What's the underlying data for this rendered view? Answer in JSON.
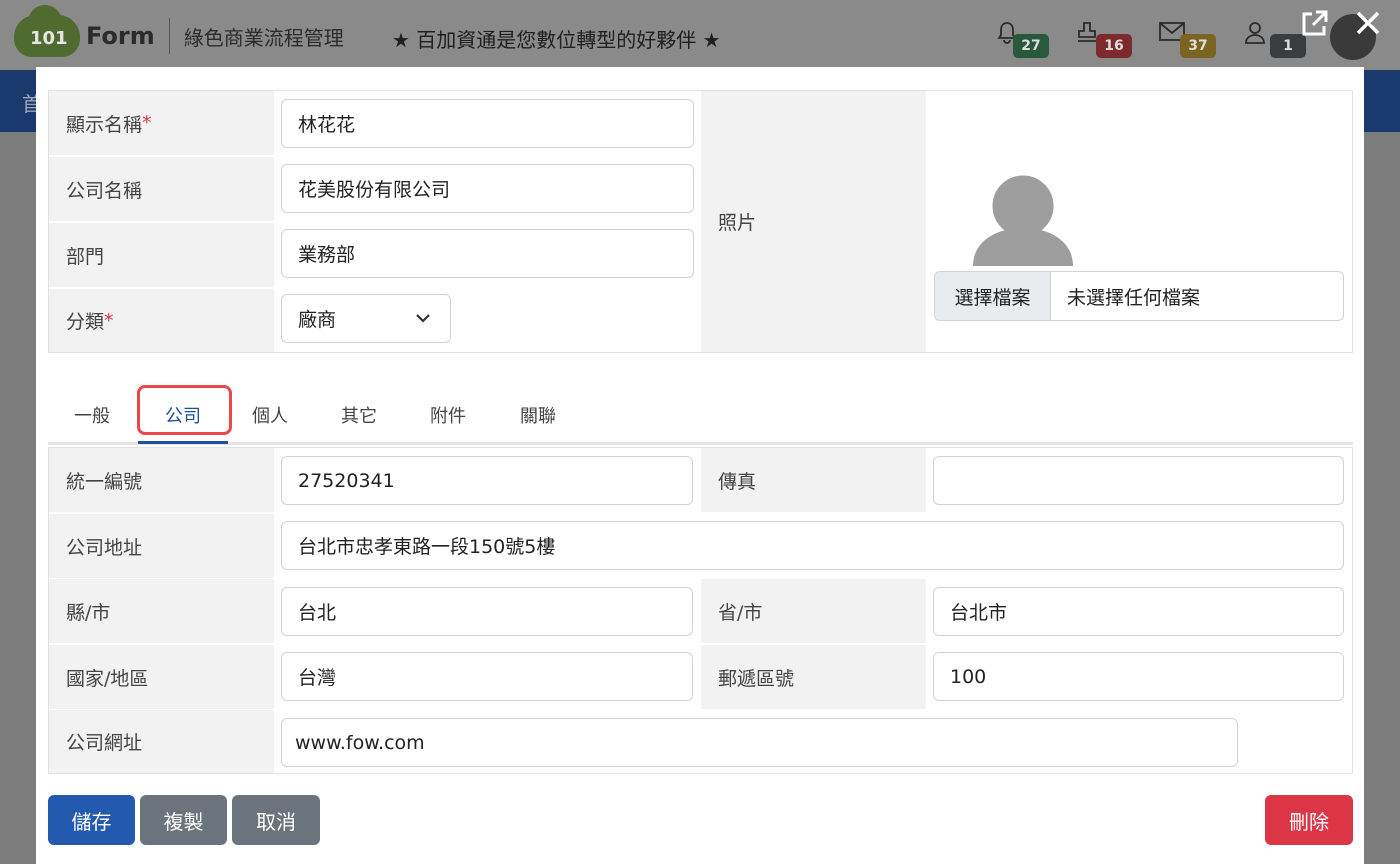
{
  "app": {
    "logo_number": "101",
    "logo_text": "Form",
    "subtitle": "綠色商業流程管理",
    "slogan": "★ 百加資通是您數位轉型的好夥伴 ★",
    "nav_first": "首"
  },
  "header_badges": {
    "notifications": "27",
    "approvals": "16",
    "messages": "37",
    "users": "1"
  },
  "colors": {
    "primary": "#2459b0",
    "danger": "#dc3545",
    "secondary": "#6b747c",
    "tab_highlight": "#e8474c"
  },
  "form": {
    "display_name_label": "顯示名稱",
    "display_name_value": "林花花",
    "company_name_label": "公司名稱",
    "company_name_value": "花美股份有限公司",
    "department_label": "部門",
    "department_value": "業務部",
    "category_label": "分類",
    "category_value": "廠商",
    "required_mark": "*",
    "photo_label": "照片",
    "file_choose_label": "選擇檔案",
    "file_none_label": "未選擇任何檔案"
  },
  "tabs": [
    {
      "label": "一般"
    },
    {
      "label": "公司"
    },
    {
      "label": "個人"
    },
    {
      "label": "其它"
    },
    {
      "label": "附件"
    },
    {
      "label": "關聯"
    }
  ],
  "active_tab": "公司",
  "company": {
    "tax_id_label": "統一編號",
    "tax_id_value": "27520341",
    "fax_label": "傳真",
    "fax_value": "",
    "address_label": "公司地址",
    "address_value": "台北市忠孝東路一段150號5樓",
    "city_label": "縣/市",
    "city_value": "台北",
    "province_label": "省/市",
    "province_value": "台北市",
    "country_label": "國家/地區",
    "country_value": "台灣",
    "postal_label": "郵遞區號",
    "postal_value": "100",
    "website_label": "公司網址",
    "website_value": "www.fow.com"
  },
  "buttons": {
    "save": "儲存",
    "copy": "複製",
    "cancel": "取消",
    "delete": "刪除"
  }
}
